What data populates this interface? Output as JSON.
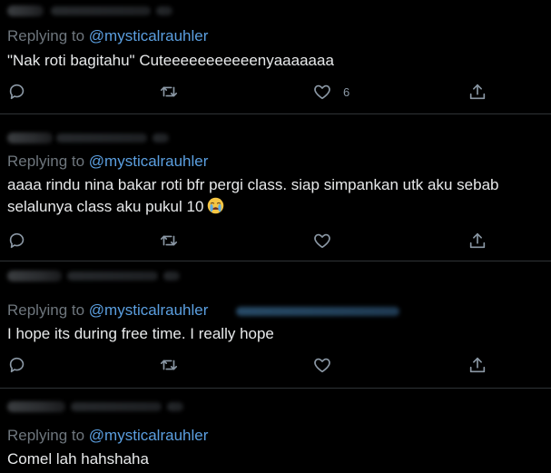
{
  "colors": {
    "background": "#000000",
    "separator": "#2f3336",
    "muted": "#6e767d",
    "link": "#5b9fe0",
    "text": "#e7e9ea",
    "icon": "#8b98a5"
  },
  "tweets": [
    {
      "replying_prefix": "Replying to",
      "replying_handle": "@mysticalrauhler",
      "text": "\"Nak roti bagitahu\" Cuteeeeeeeeeeenyaaaaaaa",
      "like_count": "6"
    },
    {
      "replying_prefix": "Replying to",
      "replying_handle": "@mysticalrauhler",
      "text_line1": "aaaa rindu nina bakar roti bfr pergi class. siap simpankan utk aku sebab",
      "text_line2": "selalunya class aku pukul 10",
      "emoji": "loudly-crying-face-icon"
    },
    {
      "replying_prefix": "Replying to",
      "replying_handle": "@mysticalrauhler",
      "text": "I hope its during free time. I really hope"
    },
    {
      "replying_prefix": "Replying to",
      "replying_handle": "@mysticalrauhler",
      "text": "Comel lah hahshaha"
    }
  ],
  "icons": {
    "reply": "reply-icon",
    "retweet": "retweet-icon",
    "like": "heart-icon",
    "share": "share-icon"
  }
}
